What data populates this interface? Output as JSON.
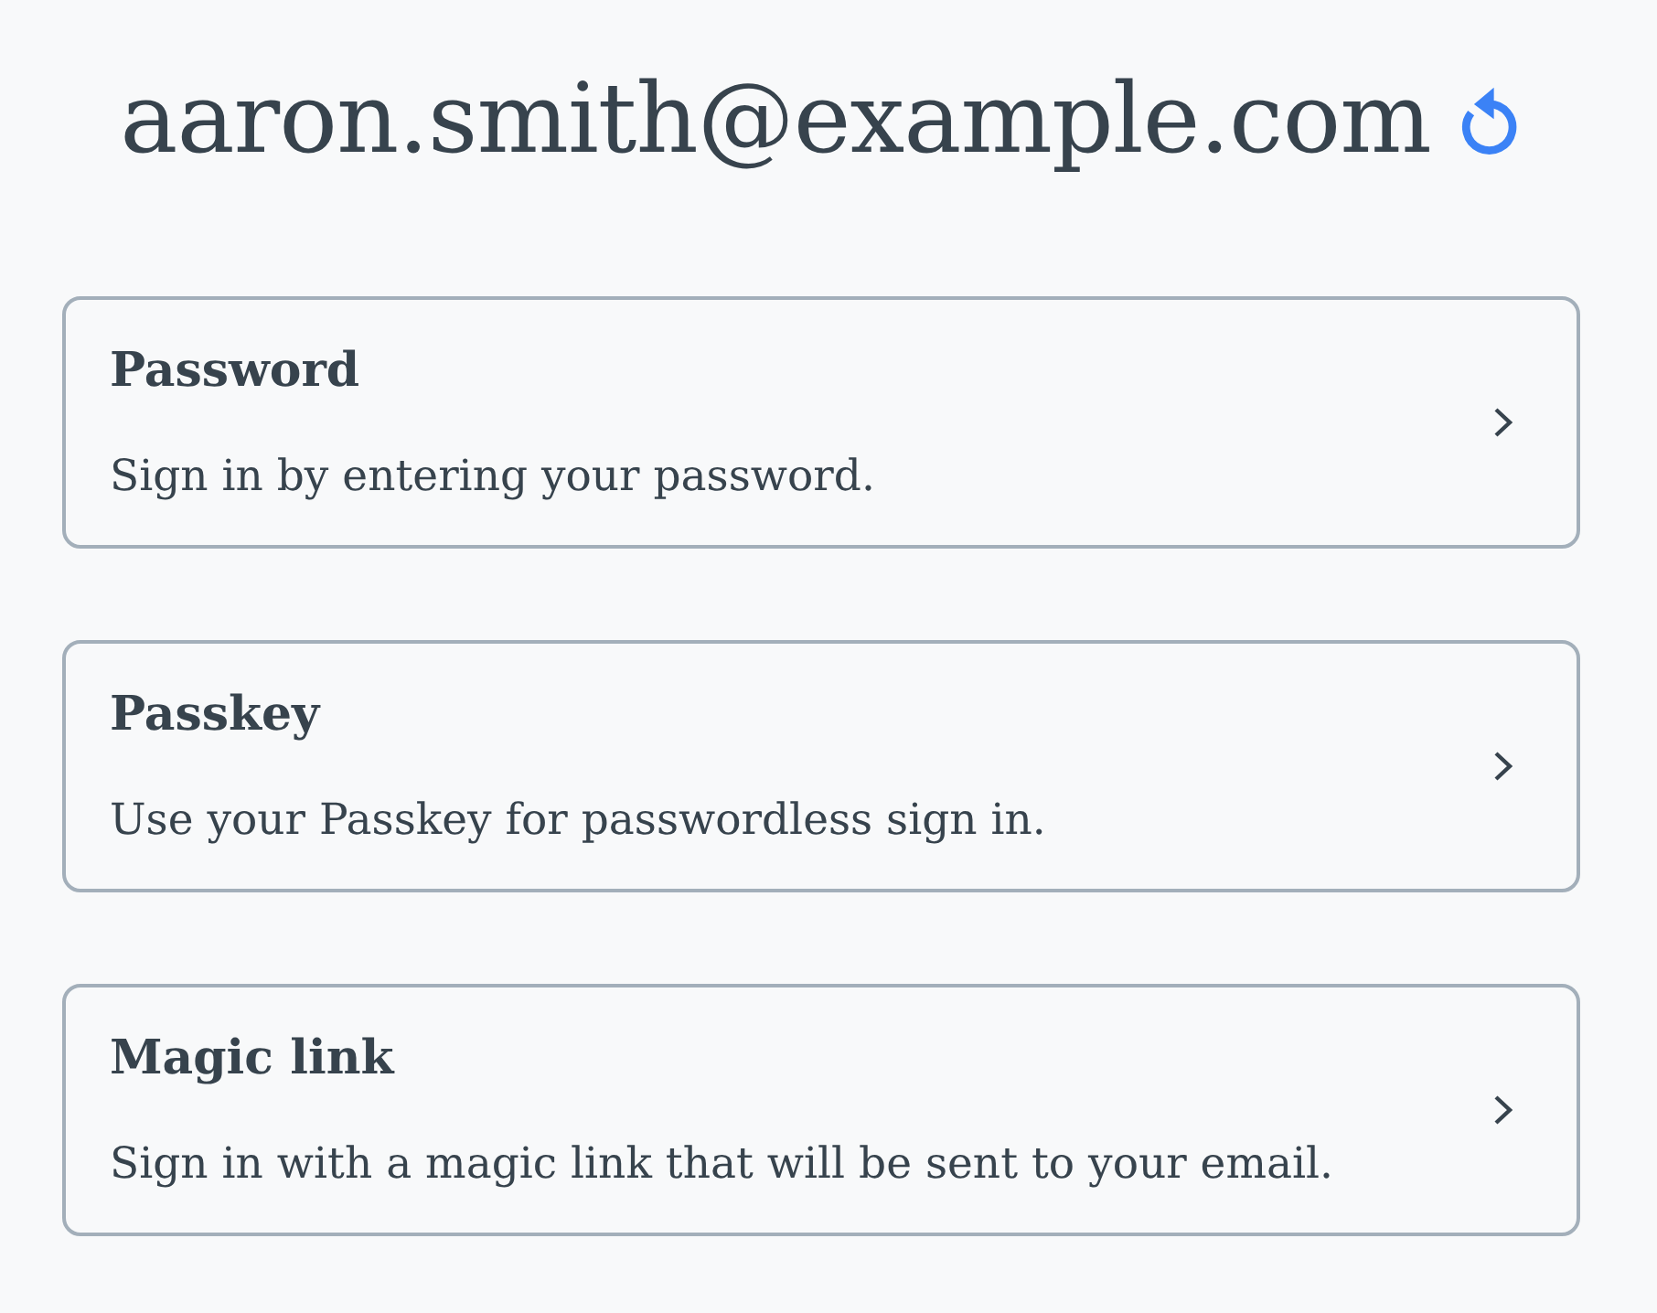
{
  "header": {
    "email": "aaron.smith@example.com"
  },
  "methods": [
    {
      "title": "Password",
      "description": "Sign in by entering your password."
    },
    {
      "title": "Passkey",
      "description": "Use your Passkey for passwordless sign in."
    },
    {
      "title": "Magic link",
      "description": "Sign in with a magic link that will be sent to your email."
    }
  ]
}
